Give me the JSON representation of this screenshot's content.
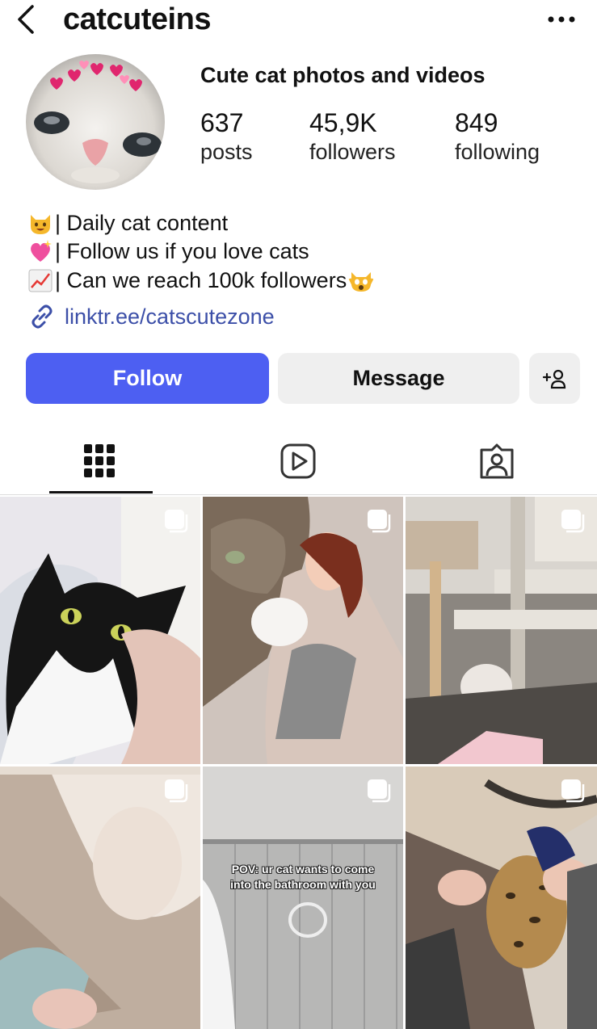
{
  "header": {
    "username": "catcuteins",
    "back_icon": "chevron-left-icon",
    "more_icon": "more-horizontal-icon"
  },
  "profile": {
    "display_name": "Cute cat photos and videos",
    "stats": [
      {
        "value": "637",
        "label": "posts"
      },
      {
        "value": "45,9K",
        "label": "followers"
      },
      {
        "value": "849",
        "label": "following"
      }
    ],
    "bio": [
      {
        "icon": "smiling-cat-emoji",
        "text": "| Daily cat content"
      },
      {
        "icon": "sparkling-heart-emoji",
        "text": "| Follow us if you love cats"
      },
      {
        "icon": "chart-increasing-emoji",
        "text": "| Can we reach 100k followers",
        "trail_icon": "weary-cat-emoji"
      }
    ],
    "link": {
      "icon": "link-icon",
      "text": "linktr.ee/catscutezone"
    }
  },
  "actions": {
    "follow_label": "Follow",
    "message_label": "Message",
    "add_user_icon": "add-person-icon"
  },
  "tabs": [
    {
      "name": "posts-grid",
      "icon": "grid-icon",
      "active": true
    },
    {
      "name": "reels",
      "icon": "reels-icon",
      "active": false
    },
    {
      "name": "tagged",
      "icon": "tagged-person-icon",
      "active": false
    }
  ],
  "grid": [
    {
      "desc": "tuxedo-cat",
      "carousel": true
    },
    {
      "desc": "cat-with-doll",
      "carousel": true
    },
    {
      "desc": "cat-tree",
      "carousel": true
    },
    {
      "desc": "cat-paw",
      "carousel": true
    },
    {
      "desc": "bathroom",
      "carousel": true,
      "caption_line1": "POV: ur cat wants to come",
      "caption_line2": "into the bathroom with you"
    },
    {
      "desc": "bengal-cat",
      "carousel": true
    }
  ],
  "colors": {
    "accent": "#4d5ff2",
    "link": "#3c4fa8",
    "button_secondary": "#efefef"
  }
}
